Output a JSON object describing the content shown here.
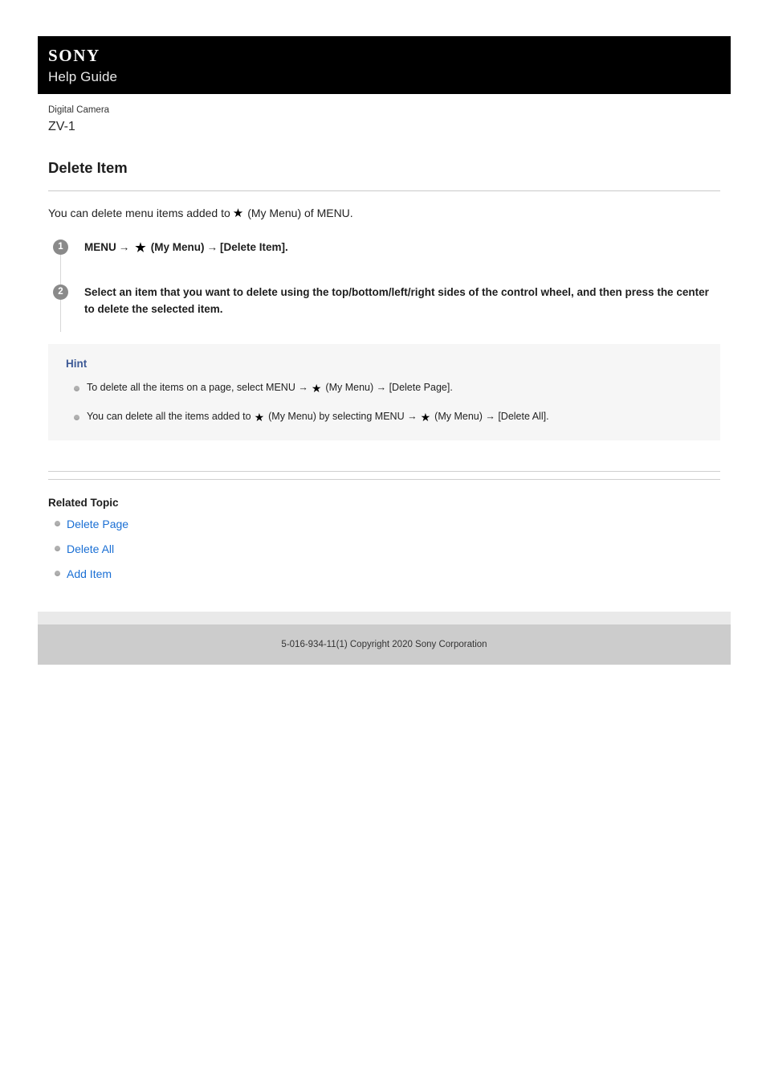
{
  "header": {
    "brand": "SONY",
    "guide_label": "Help Guide"
  },
  "product": {
    "category": "Digital Camera",
    "model": "ZV-1"
  },
  "article": {
    "title": "Delete Item",
    "intro_before": "You can delete menu items added to",
    "intro_star": "★",
    "intro_after": "(My Menu) of MENU."
  },
  "steps": [
    {
      "number": "1",
      "text_a": "MENU",
      "arrow1": "→",
      "star": "★",
      "text_b": "(My Menu)",
      "arrow2": "→",
      "text_c": "[Delete Item]."
    },
    {
      "number": "2",
      "text_a": "Select an item that you want to delete using the top/bottom/left/right sides of the control wheel, and then press the center to delete the selected item."
    }
  ],
  "hint": {
    "title": "Hint",
    "items": [
      {
        "text_a": "To delete all the items on a page, select MENU →",
        "star": "★",
        "text_b": "(My Menu) → [Delete Page]."
      },
      {
        "text_a": "You can delete all the items added to",
        "star": "★",
        "text_b": "(My Menu) by selecting MENU →",
        "star2": "★",
        "text_c": "(My Menu) → [Delete All]."
      }
    ]
  },
  "related": {
    "title": "Related Topic",
    "links": [
      {
        "label": "Delete Page"
      },
      {
        "label": "Delete All"
      },
      {
        "label": "Add Item"
      }
    ]
  },
  "footer": {
    "copyright": "5-016-934-11(1) Copyright 2020 Sony Corporation"
  },
  "colors": {
    "header_bg": "#000000",
    "link": "#1a6fd4",
    "hint_title": "#3d5a96",
    "hint_bg": "#f6f6f6",
    "footer_band": "#cccccc"
  }
}
